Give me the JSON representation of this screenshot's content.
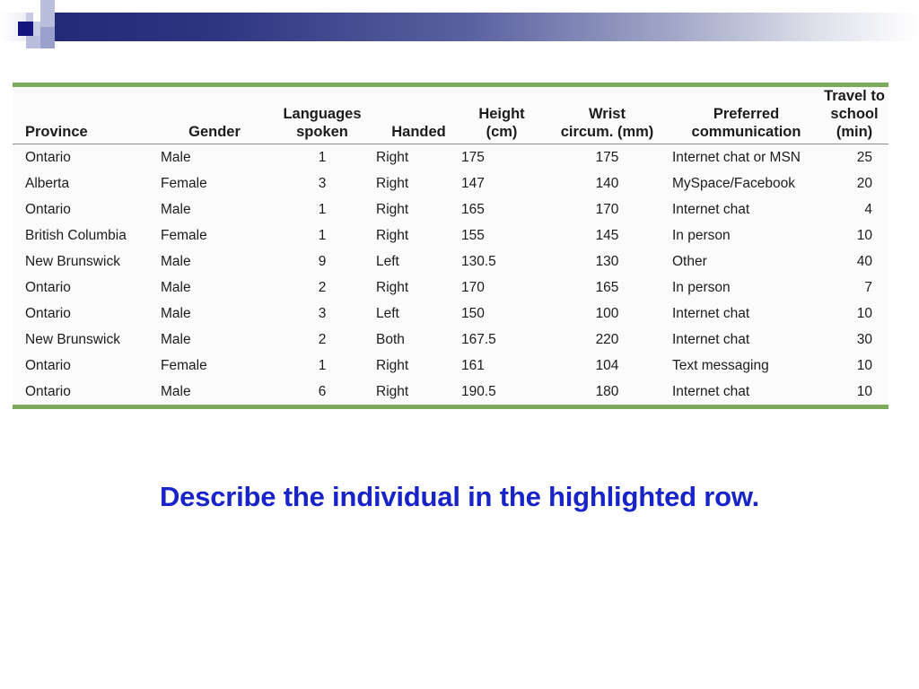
{
  "slide": {
    "banner": {
      "accent_navy": "#13147e",
      "accent_lavender": "#b9bedd",
      "gradient_from": "#232a77",
      "gradient_to": "#ffffff"
    },
    "caption": "Describe the individual in the highlighted row.",
    "caption_color": "#1823c8",
    "rule_color": "#7aab5a",
    "highlight_color": "#dee8d3"
  },
  "table": {
    "headers": [
      {
        "line1": "",
        "line2": "Province"
      },
      {
        "line1": "",
        "line2": "Gender"
      },
      {
        "line1": "Languages",
        "line2": "spoken"
      },
      {
        "line1": "",
        "line2": "Handed"
      },
      {
        "line1": "Height",
        "line2": "(cm)"
      },
      {
        "line1": "Wrist",
        "line2": "circum. (mm)"
      },
      {
        "line1": "Preferred",
        "line2": "communication"
      },
      {
        "line1": "Travel to",
        "line2": "school (min)"
      }
    ],
    "rows": [
      {
        "province": "Ontario",
        "gender": "Male",
        "languages_spoken": "1",
        "handed": "Right",
        "height_cm": "175",
        "wrist_circum_mm": "175",
        "preferred_communication": "Internet chat or MSN",
        "travel_to_school_min": "25",
        "highlighted": false
      },
      {
        "province": "Alberta",
        "gender": "Female",
        "languages_spoken": "3",
        "handed": "Right",
        "height_cm": "147",
        "wrist_circum_mm": "140",
        "preferred_communication": "MySpace/Facebook",
        "travel_to_school_min": "20",
        "highlighted": false
      },
      {
        "province": "Ontario",
        "gender": "Male",
        "languages_spoken": "1",
        "handed": "Right",
        "height_cm": "165",
        "wrist_circum_mm": "170",
        "preferred_communication": "Internet chat",
        "travel_to_school_min": "4",
        "highlighted": false
      },
      {
        "province": "British Columbia",
        "gender": "Female",
        "languages_spoken": "1",
        "handed": "Right",
        "height_cm": "155",
        "wrist_circum_mm": "145",
        "preferred_communication": "In person",
        "travel_to_school_min": "10",
        "highlighted": false
      },
      {
        "province": "New Brunswick",
        "gender": "Male",
        "languages_spoken": "9",
        "handed": "Left",
        "height_cm": "130.5",
        "wrist_circum_mm": "130",
        "preferred_communication": "Other",
        "travel_to_school_min": "40",
        "highlighted": false
      },
      {
        "province": "Ontario",
        "gender": "Male",
        "languages_spoken": "2",
        "handed": "Right",
        "height_cm": "170",
        "wrist_circum_mm": "165",
        "preferred_communication": "In person",
        "travel_to_school_min": "7",
        "highlighted": false
      },
      {
        "province": "Ontario",
        "gender": "Male",
        "languages_spoken": "3",
        "handed": "Left",
        "height_cm": "150",
        "wrist_circum_mm": "100",
        "preferred_communication": "Internet chat",
        "travel_to_school_min": "10",
        "highlighted": true
      },
      {
        "province": "New Brunswick",
        "gender": "Male",
        "languages_spoken": "2",
        "handed": "Both",
        "height_cm": "167.5",
        "wrist_circum_mm": "220",
        "preferred_communication": "Internet chat",
        "travel_to_school_min": "30",
        "highlighted": false
      },
      {
        "province": "Ontario",
        "gender": "Female",
        "languages_spoken": "1",
        "handed": "Right",
        "height_cm": "161",
        "wrist_circum_mm": "104",
        "preferred_communication": "Text messaging",
        "travel_to_school_min": "10",
        "highlighted": false
      },
      {
        "province": "Ontario",
        "gender": "Male",
        "languages_spoken": "6",
        "handed": "Right",
        "height_cm": "190.5",
        "wrist_circum_mm": "180",
        "preferred_communication": "Internet chat",
        "travel_to_school_min": "10",
        "highlighted": false
      }
    ]
  }
}
